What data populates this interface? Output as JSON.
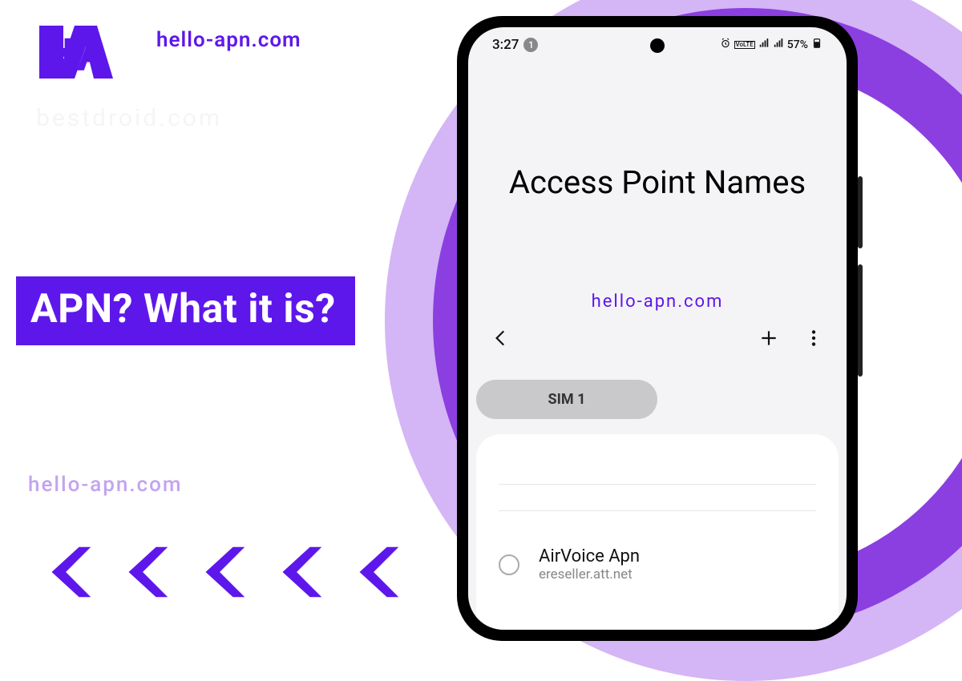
{
  "brand": {
    "logo_text": "H·A",
    "domain": "hello-apn.com",
    "watermark_faint": "bestdroid.com"
  },
  "headline": "APN? What it is?",
  "colors": {
    "primary": "#5e17eb",
    "primary_light": "#d4b5f5",
    "primary_mid": "#8b3fe0"
  },
  "phone": {
    "statusbar": {
      "time": "3:27",
      "notification_count": "1",
      "battery_percent": "57%"
    },
    "page_title": "Access Point Names",
    "watermark": "hello-apn.com",
    "tabs": {
      "active": "SIM 1"
    },
    "apn_list": [
      {
        "name": "AirVoice Apn",
        "apn": "ereseller.att.net",
        "selected": false
      }
    ]
  }
}
